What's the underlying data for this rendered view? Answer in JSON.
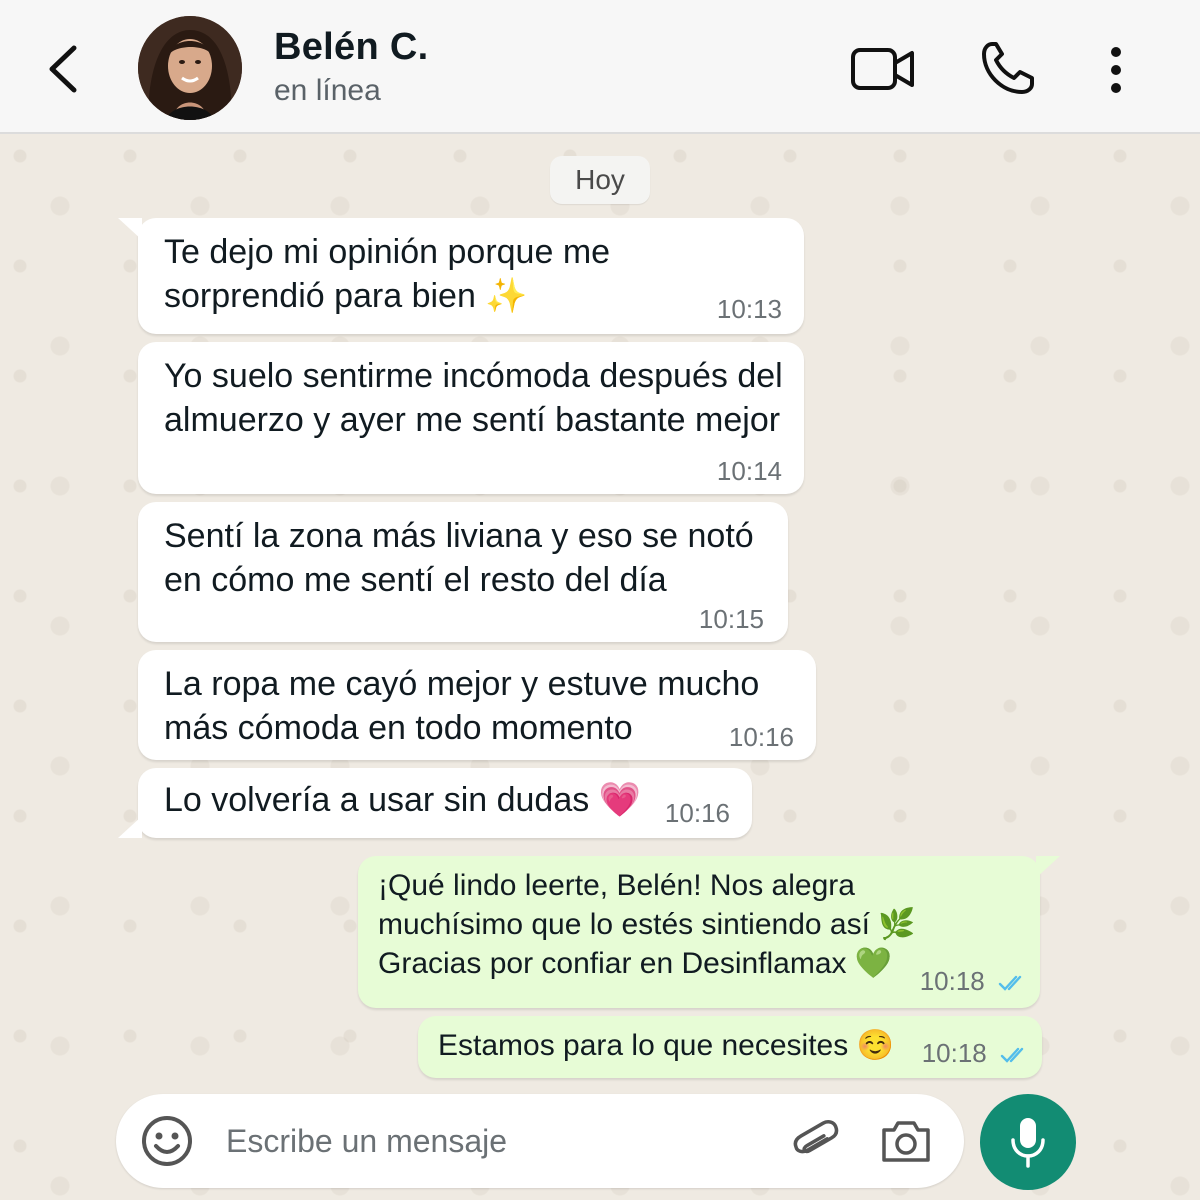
{
  "header": {
    "contact_name": "Belén C.",
    "status": "en línea"
  },
  "chat": {
    "date_label": "Hoy",
    "messages": [
      {
        "direction": "in",
        "text": "Te dejo mi opinión porque me sorprendió para bien ✨",
        "time": "10:13"
      },
      {
        "direction": "in",
        "text": "Yo suelo sentirme incómoda después del almuerzo y ayer me sentí bastante mejor",
        "time": "10:14"
      },
      {
        "direction": "in",
        "text": "Sentí la zona más liviana y eso se notó en cómo me sentí el resto del día",
        "time": "10:15"
      },
      {
        "direction": "in",
        "text": "La ropa me cayó mejor y estuve mucho más cómoda en todo momento",
        "time": "10:16"
      },
      {
        "direction": "in",
        "text": "Lo volvería a usar sin dudas 💗",
        "time": "10:16"
      },
      {
        "direction": "out",
        "text": "¡Qué lindo leerte, Belén! Nos alegra muchísimo que lo estés sintiendo así 🌿 Gracias por confiar en Desinflamax 💚",
        "time": "10:18",
        "read": true
      },
      {
        "direction": "out",
        "text": "Estamos para lo que necesites ☺️",
        "time": "10:18",
        "read": true
      }
    ]
  },
  "input": {
    "placeholder": "Escribe un mensaje"
  },
  "colors": {
    "accent": "#128c73",
    "outgoing_bubble": "#e7fcd6",
    "incoming_bubble": "#ffffff",
    "read_ticks": "#53bdeb"
  },
  "icons": [
    "back-arrow-icon",
    "video-call-icon",
    "phone-icon",
    "more-vert-icon",
    "emoji-icon",
    "attach-icon",
    "camera-icon",
    "mic-icon",
    "double-check-icon"
  ]
}
